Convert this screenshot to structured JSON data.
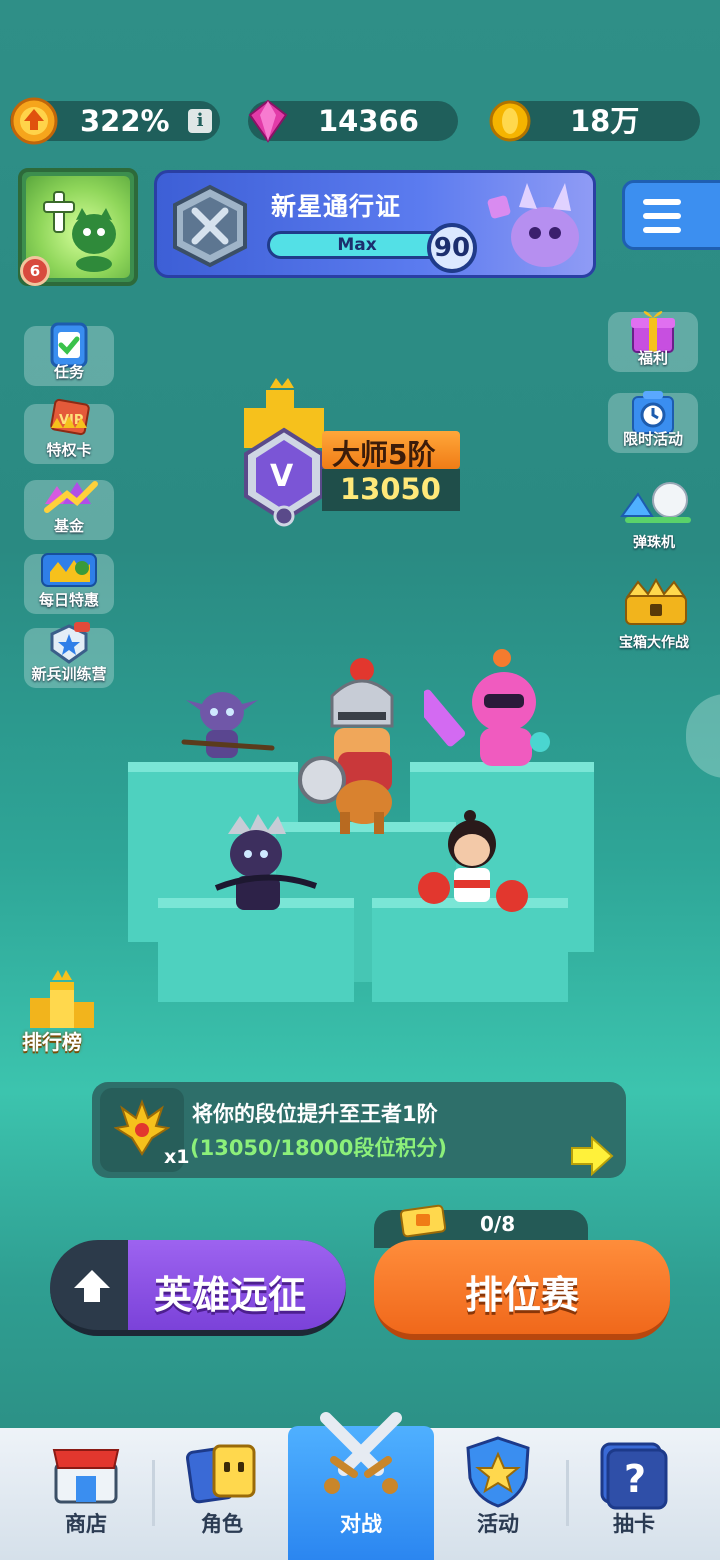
{
  "resources": {
    "rate": "322%",
    "gems": "14366",
    "gold": "18万",
    "info_icon": "i"
  },
  "profile": {
    "level": "6"
  },
  "pass": {
    "title": "新星通行证",
    "bar_label": "Max",
    "level": "90"
  },
  "left_menu": [
    {
      "label": "任务",
      "icon": "task-clipboard-icon"
    },
    {
      "label": "特权卡",
      "icon": "vip-card-icon"
    },
    {
      "label": "基金",
      "icon": "fund-crystal-icon"
    },
    {
      "label": "每日特惠",
      "icon": "daily-deal-icon"
    },
    {
      "label": "新兵训练营",
      "icon": "recruit-camp-icon"
    }
  ],
  "right_menu": [
    {
      "label": "福利",
      "icon": "gift-box-icon"
    },
    {
      "label": "限时活动",
      "icon": "timed-event-icon"
    },
    {
      "label": "弹珠机",
      "icon": "pinball-icon"
    },
    {
      "label": "宝箱大作战",
      "icon": "chest-battle-icon"
    }
  ],
  "rank": {
    "tier_letter": "V",
    "name": "大师5阶",
    "score": "13050"
  },
  "leaderboard": {
    "label": "排行榜"
  },
  "quest": {
    "title": "将你的段位提升至王者1阶",
    "progress_text": "(13050/18000段位积分)",
    "reward_count": "x1",
    "progress": {
      "current": 13050,
      "target": 18000
    }
  },
  "tickets": {
    "count": "0/8"
  },
  "buttons": {
    "expedition": "英雄远征",
    "ranked": "排位赛"
  },
  "nav": [
    {
      "label": "商店",
      "icon": "shop-icon",
      "active": false
    },
    {
      "label": "角色",
      "icon": "characters-icon",
      "active": false
    },
    {
      "label": "对战",
      "icon": "crossed-swords-icon",
      "active": true
    },
    {
      "label": "活动",
      "icon": "star-shield-icon",
      "active": false
    },
    {
      "label": "抽卡",
      "icon": "mystery-card-icon",
      "active": false
    }
  ],
  "colors": {
    "background": "#2f8f87",
    "accent_orange": "#f07c16",
    "accent_purple": "#7b42d9",
    "nav_active": "#2b86f0"
  }
}
